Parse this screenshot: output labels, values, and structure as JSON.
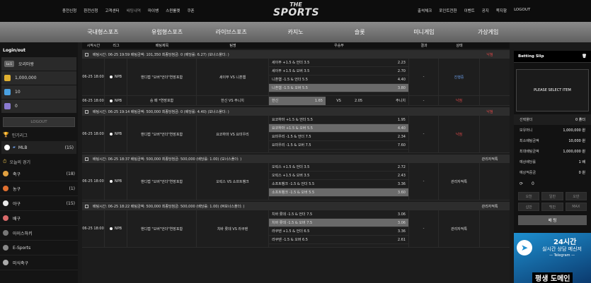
{
  "top_nav_left": [
    "충전신청",
    "환전신청",
    "고객센터",
    "배팅내역",
    "마이뱅",
    "스윈룰렛",
    "쿠폰"
  ],
  "top_nav_right": [
    "출석체크",
    "포인트전환",
    "이벤트",
    "공지",
    "쪽지함",
    "LOGOUT"
  ],
  "logo": {
    "line1": "THE",
    "line2": "SPORTS"
  },
  "menu": [
    "국내형스포츠",
    "유럽형스포츠",
    "라이브스포츠",
    "카지노",
    "슬롯",
    "미니게임",
    "가상게임"
  ],
  "sidebar": {
    "title": "Login/out",
    "rows": [
      {
        "icon": "Lv.1",
        "value": "오리마왕"
      },
      {
        "icon": "coin",
        "value": "1,000,000"
      },
      {
        "icon": "point",
        "value": "10"
      },
      {
        "icon": "mail",
        "value": "0"
      }
    ],
    "logout_label": "LOGOUT",
    "popular_title": "인기리그",
    "popular": {
      "name": "MLB",
      "count": "(15)"
    },
    "today_title": "오늘의 경기",
    "sports": [
      {
        "name": "축구",
        "count": "(18)",
        "color": "#e0a040"
      },
      {
        "name": "농구",
        "count": "(1)",
        "color": "#e07030"
      },
      {
        "name": "야구",
        "count": "(15)",
        "color": "#e8e8e8"
      },
      {
        "name": "배구",
        "count": "",
        "color": "#d96a6a"
      },
      {
        "name": "아이스하키",
        "count": "",
        "color": "#777"
      },
      {
        "name": "E-Sports",
        "count": "",
        "color": "#888"
      },
      {
        "name": "미식축구",
        "count": "",
        "color": "#aaa"
      }
    ]
  },
  "table_headers": [
    "시작시간",
    "리그",
    "배팅제목",
    "팀명",
    "우승부",
    "결과",
    "상태"
  ],
  "bets": [
    {
      "head": {
        "time": "배팅시간: 06-25 19:59",
        "amount": "배팅금액: 101,350",
        "win": "최종당첨금: 0",
        "odds": "(배당률: 6.27)",
        "bonus": "(보너스폴더: )",
        "status": "낙첨"
      },
      "rows": [
        {
          "start": "06-25 18:00",
          "league": "NPB",
          "title": "핸디캡 \"오버\"언더\"연장포함",
          "team": "세이부 VS 니혼햄",
          "options": [
            {
              "name": "세이부 +1.5 & 언더 3.5",
              "odds": "2.23"
            },
            {
              "name": "세이부 +1.5 & 오버 3.5",
              "odds": "2.70"
            },
            {
              "name": "니혼햄 -1.5 & 언더 5.5",
              "odds": "4.40"
            },
            {
              "name": "니혼햄 -1.5 & 오버 5.5",
              "odds": "3.80",
              "selected": true
            }
          ],
          "result": "-",
          "status": "진행중"
        }
      ],
      "extra": {
        "start": "06-25 18:00",
        "league": "NPB",
        "title": "승 패 *연장포함",
        "team": "한신 VS 주니치",
        "home": "한신",
        "home_odds": "1.65",
        "vs": "VS",
        "away_odds": "2.05",
        "away": "주니치",
        "result": "-",
        "status": "낙첨"
      }
    },
    {
      "head": {
        "time": "배팅시간: 06-25 19:14",
        "amount": "배팅금액: 500,000",
        "win": "최종당첨금: 0",
        "odds": "(배당률: 4.40)",
        "bonus": "(보너스폴더: )",
        "status": "낙첨"
      },
      "rows": [
        {
          "start": "06-25 18:00",
          "league": "NPB",
          "title": "핸디캡 \"오버\"언더\"연장포함",
          "team": "요코하마 VS 요미우리",
          "options": [
            {
              "name": "요코하마 +1.5 & 언더 5.5",
              "odds": "1.95"
            },
            {
              "name": "요코하마 +1.5 & 오버 5.5",
              "odds": "4.40",
              "selected": true
            },
            {
              "name": "요미우리 -1.5 & 언더 7.5",
              "odds": "2.34"
            },
            {
              "name": "요미우리 -1.5 & 오버 7.5",
              "odds": "7.60"
            }
          ],
          "result": "-",
          "status": "낙첨"
        }
      ]
    },
    {
      "head": {
        "time": "배팅시간: 06-25 18:37",
        "amount": "배팅금액: 500,000",
        "win": "최종당첨금: 500,000",
        "odds": "(배당률: 1.00)",
        "bonus": "(보너스폴더: )",
        "status": "관리자적특"
      },
      "rows": [
        {
          "start": "06-25 18:00",
          "league": "NPB",
          "title": "핸디캡 \"오버\"언더\"연장포함",
          "team": "오릭스 VS 소프트뱅크",
          "options": [
            {
              "name": "오릭스 +1.5 & 언더 3.5",
              "odds": "2.72"
            },
            {
              "name": "오릭스 +1.5 & 오버 3.5",
              "odds": "2.43"
            },
            {
              "name": "소프트뱅크 -1.5 & 언더 5.5",
              "odds": "3.36"
            },
            {
              "name": "소프트뱅크 -1.5 & 오버 5.5",
              "odds": "3.60",
              "selected": true
            }
          ],
          "result": "-",
          "status": "관리자적특"
        }
      ]
    },
    {
      "head": {
        "time": "배팅시간: 06-25 18:22",
        "amount": "배팅금액: 500,000",
        "win": "최종당첨금: 500,000",
        "odds": "(배당률: 1.00)",
        "bonus": "(M보너스폴더: )",
        "status": "관리자적특"
      },
      "rows": [
        {
          "start": "06-25 18:00",
          "league": "NPB",
          "title": "핸디캡 \"오버\"언더\"연장포함",
          "team": "치바 롯데 VS 라쿠텐",
          "options": [
            {
              "name": "치바 롯데 -1.5 & 언더 7.5",
              "odds": "3.06"
            },
            {
              "name": "치바 롯데 -1.5 & 오버 7.5",
              "odds": "3.06",
              "selected": true
            },
            {
              "name": "라쿠텐 +1.5 & 언더 6.5",
              "odds": "3.36"
            },
            {
              "name": "라쿠텐 -1.5 & 오버 6.5",
              "odds": "2.61"
            }
          ],
          "result": "-",
          "status": "관리자적특"
        }
      ]
    }
  ],
  "betslip": {
    "title": "Betting Slip",
    "empty": "PLEASE SELECT ITEM",
    "lines": [
      {
        "label": "선택폴더",
        "value": "0 폴더",
        "hl": true
      },
      {
        "label": "보유머니",
        "value": "1,000,000 원"
      },
      {
        "label": "최소배팅금액",
        "value": "10,000 원"
      },
      {
        "label": "최대배팅금액",
        "value": "1,000,000 원"
      },
      {
        "label": "예상배당률",
        "value": "1 배"
      },
      {
        "label": "예상적중금",
        "value": "0 원"
      }
    ],
    "input_value": "0",
    "quick": [
      "오천",
      "일만",
      "오만",
      "십만",
      "백만",
      "MAX"
    ],
    "bet_label": "배 팅"
  },
  "promo": {
    "t1": "24시간",
    "t2": "실시간 상담 메신저",
    "t3": "— Telegram —",
    "t4": "평생 도메인"
  }
}
